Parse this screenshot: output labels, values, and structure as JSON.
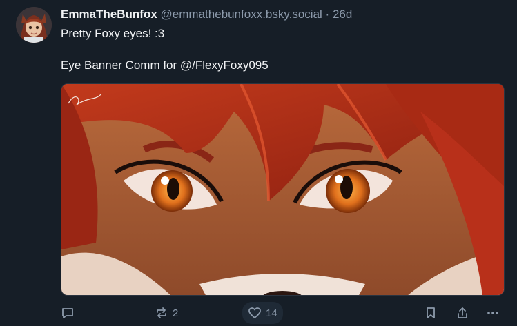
{
  "post": {
    "author": {
      "display_name": "EmmaTheBunfox",
      "handle": "@emmathebunfoxx.bsky.social",
      "separator": "·",
      "timestamp": "26d"
    },
    "text_lines": [
      "Pretty Foxy eyes! :3",
      "",
      "Eye Banner Comm for @/FlexyFoxy095"
    ],
    "media": {
      "description_icon": "image"
    },
    "actions": {
      "reply": {
        "icon": "reply-icon",
        "count": ""
      },
      "repost": {
        "icon": "repost-icon",
        "count": "2"
      },
      "like": {
        "icon": "heart-icon",
        "count": "14"
      },
      "bookmark": {
        "icon": "bookmark-icon"
      },
      "share": {
        "icon": "share-icon"
      },
      "more": {
        "icon": "more-icon"
      }
    }
  },
  "colors": {
    "background": "#161e27",
    "text": "#f1f3f5",
    "muted": "#8c9aab",
    "like_bg": "#1f2a36"
  }
}
